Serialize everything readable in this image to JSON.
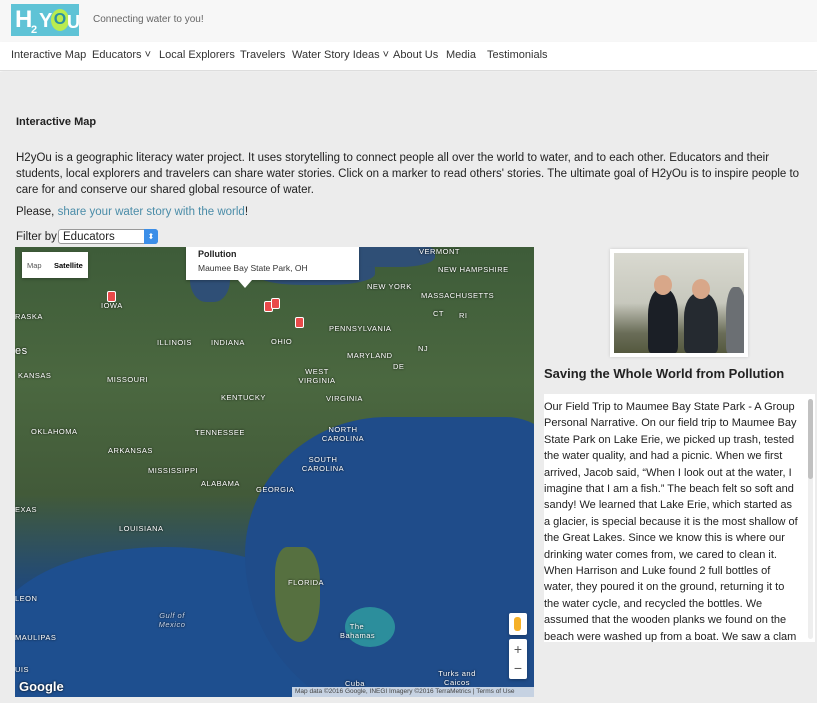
{
  "header": {
    "logo_text": "H2YOu",
    "tagline": "Connecting water to you!"
  },
  "nav": {
    "items": [
      {
        "label": "Interactive Map"
      },
      {
        "label": "Educators ˅"
      },
      {
        "label": "Local Explorers"
      },
      {
        "label": "Travelers"
      },
      {
        "label": "Water Story Ideas ˅"
      },
      {
        "label": "About Us"
      },
      {
        "label": "Media"
      },
      {
        "label": "Testimonials"
      }
    ]
  },
  "page": {
    "title": "Interactive Map",
    "intro": "H2yOu is a geographic literacy water project. It uses storytelling to connect people all over the world to water, and to each other.  Educators and their students, local explorers and travelers can share water stories.  Click on a marker to read others' stories.  The ultimate goal of H2yOu is to inspire people to care for and conserve our shared global resource of water.",
    "please_prefix": "Please, ",
    "please_link": "share your water story with the world",
    "please_suffix": "!",
    "filter_label": "Filter by",
    "filter_value": "Educators"
  },
  "map": {
    "type_map": "Map",
    "type_satellite": "Satellite",
    "info_title": "Pollution",
    "info_subtitle": "Maumee Bay State Park, OH",
    "labels": {
      "vermont": "VERMONT",
      "new_hampshire": "NEW HAMPSHIRE",
      "new_york": "NEW YORK",
      "massachusetts": "MASSACHUSETTS",
      "ct": "CT",
      "ri": "RI",
      "iowa": "IOWA",
      "raska": "RASKA",
      "es": "es",
      "illinois": "ILLINOIS",
      "indiana": "INDIANA",
      "ohio": "OHIO",
      "pennsylvania": "PENNSYLVANIA",
      "nj": "NJ",
      "maryland": "MARYLAND",
      "de": "DE",
      "kansas": "KANSAS",
      "missouri": "MISSOURI",
      "west_virginia": "WEST VIRGINIA",
      "kentucky": "KENTUCKY",
      "virginia": "VIRGINIA",
      "oklahoma": "OKLAHOMA",
      "tennessee": "TENNESSEE",
      "north_carolina": "NORTH CAROLINA",
      "arkansas": "ARKANSAS",
      "south_carolina": "SOUTH CAROLINA",
      "mississippi": "MISSISSIPPI",
      "alabama": "ALABAMA",
      "georgia": "GEORGIA",
      "exas": "EXAS",
      "louisiana": "LOUISIANA",
      "florida": "FLORIDA",
      "leon": "LEON",
      "gulf": "Gulf of Mexico",
      "bahamas": "The Bahamas",
      "maulipas": "MAULIPAS",
      "uis": "UIS",
      "turks": "Turks and Caicos",
      "cuba": "Cuba"
    },
    "google": "Google",
    "attribution": "Map data ©2016 Google, INEGI Imagery ©2016 TerraMetrics | Terms of Use",
    "zoom_in": "+",
    "zoom_out": "−"
  },
  "story": {
    "title": "Saving the Whole World from Pollution",
    "body": "Our Field Trip to Maumee Bay State Park - A Group Personal Narrative. On our field trip to Maumee Bay State Park on Lake Erie, we picked up trash, tested the water quality, and had a picnic. When we first arrived, Jacob said, “When I look out at the water, I imagine that I am a fish.” The beach felt so soft and sandy! We learned that Lake Erie, which started as a glacier, is special because it is the most shallow of the Great Lakes. Since we know this is where our drinking water comes from, we cared to clean it. When Harrison and Luke found 2 full bottles of water, they poured it on the ground, returning it to the water cycle, and recycled the bottles. We assumed that the wooden planks we found on the beach were washed up from a boat. We saw a clam"
  }
}
